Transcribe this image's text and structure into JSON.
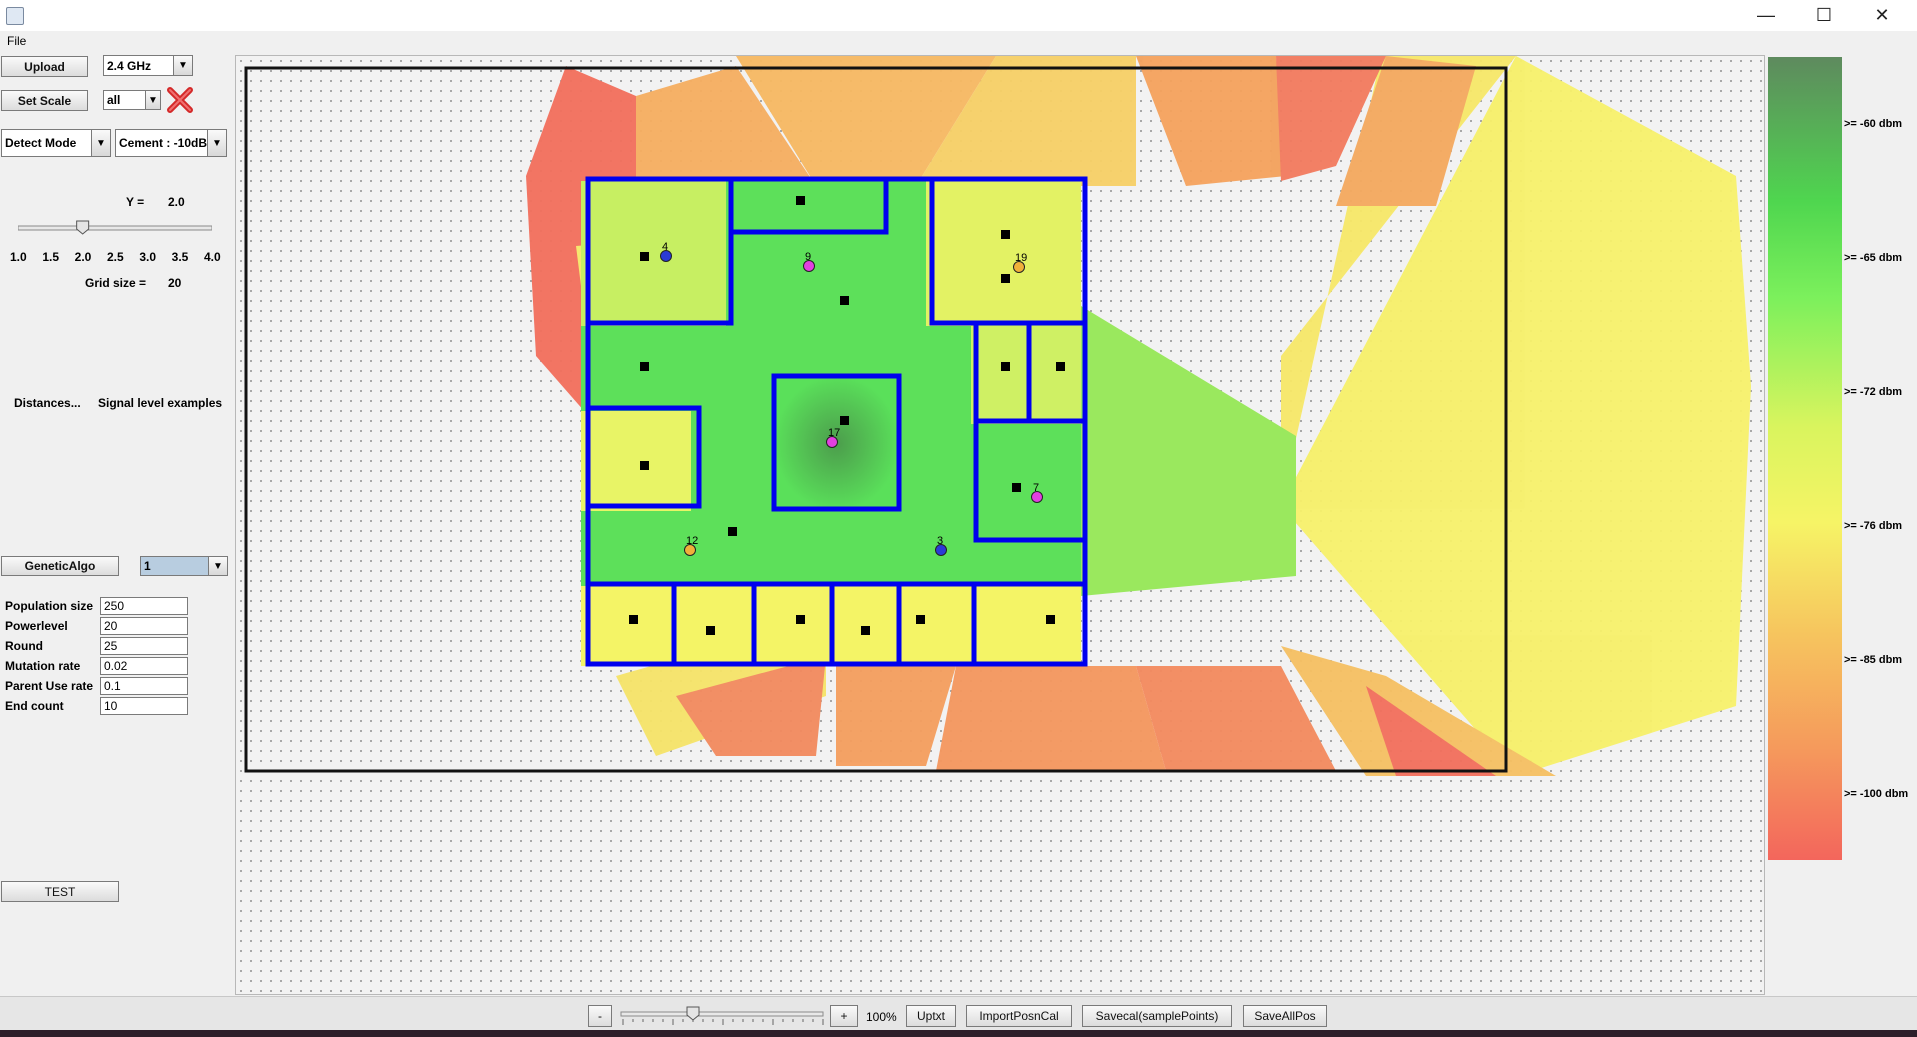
{
  "window": {
    "minimize_glyph": "—",
    "maximize_glyph": "☐",
    "close_glyph": "✕"
  },
  "menu": {
    "file": "File"
  },
  "left": {
    "upload": "Upload",
    "band": "2.4 GHz",
    "set_scale": "Set Scale",
    "scope": "all",
    "detect_mode": "Detect Mode",
    "material": "Cement : -10dB",
    "gamma_label": "Y =",
    "gamma_value": "2.0",
    "gamma_slider_value": 2.0,
    "slider_ticks": [
      "1.0",
      "1.5",
      "2.0",
      "2.5",
      "3.0",
      "3.5",
      "4.0"
    ],
    "grid_label": "Grid size  =",
    "grid_value": "20",
    "distances": "Distances...",
    "signal_examples": "Signal level examples",
    "algo_button": "GeneticAlgo",
    "algo_select": "1",
    "params": [
      {
        "label": "Population size",
        "value": "250"
      },
      {
        "label": "Powerlevel",
        "value": "20"
      },
      {
        "label": "Round",
        "value": "25"
      },
      {
        "label": "Mutation rate",
        "value": "0.02"
      },
      {
        "label": "Parent Use rate",
        "value": "0.1"
      },
      {
        "label": "End count",
        "value": "10"
      }
    ],
    "test": "TEST"
  },
  "legend": {
    "labels": [
      ">= -60 dbm",
      ">= -65 dbm",
      ">= -72 dbm",
      ">= -76 dbm",
      ">= -85 dbm",
      ">= -100 dbm"
    ],
    "colors": {
      "top": "#5e8a5e",
      "green": "#4fd64f",
      "yellow": "#f6f466",
      "orange": "#f59a5c",
      "red": "#f3665c"
    }
  },
  "map": {
    "wall_color": "#0000ee",
    "access_points": [
      {
        "label": "4",
        "color": "#2b3bd6"
      },
      {
        "label": "9",
        "color": "#e23fe0"
      },
      {
        "label": "19",
        "color": "#f0b03a"
      },
      {
        "label": "17",
        "color": "#e23fe0"
      },
      {
        "label": "7",
        "color": "#e23fe0"
      },
      {
        "label": "12",
        "color": "#f0b03a"
      },
      {
        "label": "3",
        "color": "#2b3bd6"
      }
    ]
  },
  "bottom": {
    "zoom_out": "-",
    "zoom_in": "+",
    "zoom_level": "100%",
    "zoom_slider_value": 0.35,
    "uptxt": "Uptxt",
    "import": "ImportPosnCal",
    "savecal": "Savecal(samplePoints)",
    "saveall": "SaveAllPos"
  }
}
